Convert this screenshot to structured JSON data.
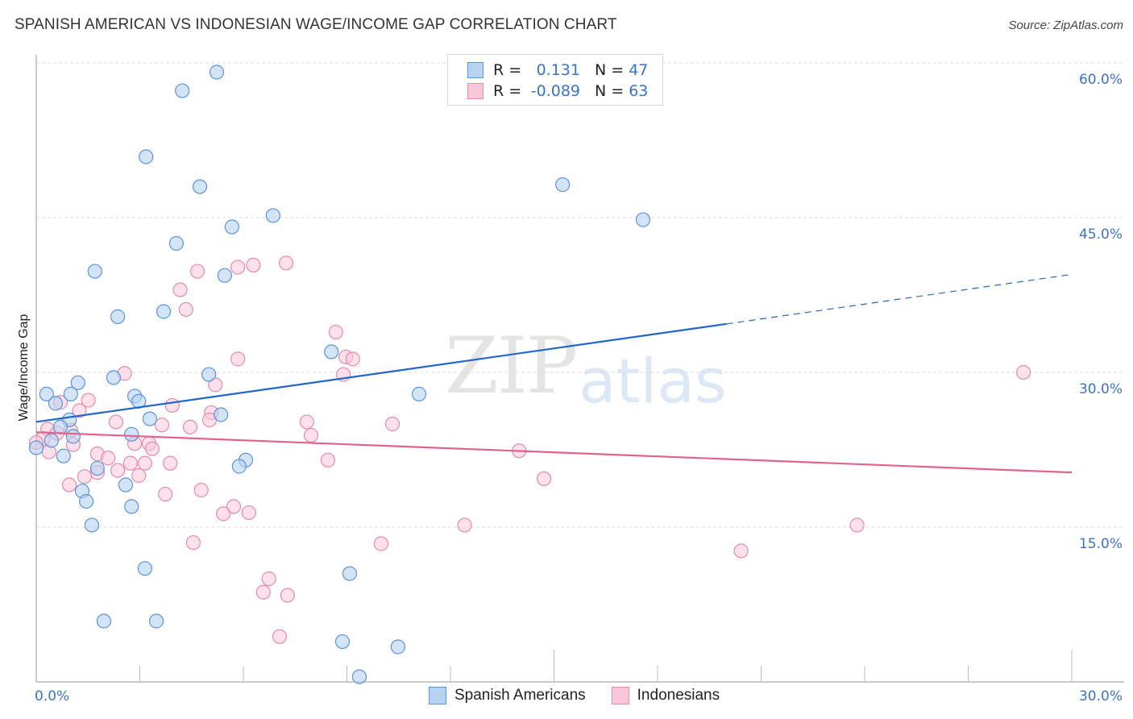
{
  "header": {
    "title": "SPANISH AMERICAN VS INDONESIAN WAGE/INCOME GAP CORRELATION CHART",
    "source": "Source: ZipAtlas.com"
  },
  "watermark": {
    "zip": "ZIP",
    "atlas": "atlas"
  },
  "legend": {
    "rows": [
      {
        "r_label": "R =",
        "r_value": "0.131",
        "n_label": "N =",
        "n_value": "47"
      },
      {
        "r_label": "R =",
        "r_value": "-0.089",
        "n_label": "N =",
        "n_value": "63"
      }
    ]
  },
  "bottom_legend": [
    {
      "label": "Spanish Americans"
    },
    {
      "label": "Indonesians"
    }
  ],
  "colors": {
    "blue_fill": "#b8d2f2",
    "blue_stroke": "#5b93dc",
    "blue_line": "#2266cc",
    "pink_fill": "#f9c8d8",
    "pink_stroke": "#e88aa8",
    "pink_line": "#e0638e",
    "tick_text": "#3a74c9"
  },
  "chart_data": {
    "type": "scatter",
    "title": "SPANISH AMERICAN VS INDONESIAN WAGE/INCOME GAP CORRELATION CHART",
    "xlabel": "",
    "ylabel": "Wage/Income Gap",
    "xlim": [
      0,
      30
    ],
    "ylim": [
      0,
      63
    ],
    "x_tick_labels": [
      "0.0%",
      "30.0%"
    ],
    "y_ticks": [
      15,
      30,
      45,
      60
    ],
    "y_tick_labels": [
      "15.0%",
      "30.0%",
      "45.0%",
      "60.0%"
    ],
    "grid": true,
    "legend_position": "top-center",
    "series": [
      {
        "name": "Spanish Americans",
        "r": 0.131,
        "n": 47,
        "trend": {
          "x0": 0,
          "y0": 25.2,
          "x1": 20,
          "y1": 34.7,
          "dashed_to_x": 30,
          "dashed_to_y": 39.5
        },
        "points": [
          [
            5.23,
            59.1
          ],
          [
            4.23,
            57.3
          ],
          [
            3.18,
            50.9
          ],
          [
            4.74,
            48.0
          ],
          [
            15.25,
            48.2
          ],
          [
            6.86,
            45.2
          ],
          [
            17.58,
            44.8
          ],
          [
            5.67,
            44.1
          ],
          [
            4.06,
            42.5
          ],
          [
            5.46,
            39.4
          ],
          [
            1.7,
            39.8
          ],
          [
            2.36,
            35.4
          ],
          [
            3.69,
            35.9
          ],
          [
            8.55,
            32.0
          ],
          [
            1.21,
            29.0
          ],
          [
            2.24,
            29.5
          ],
          [
            5.0,
            29.8
          ],
          [
            11.09,
            27.9
          ],
          [
            0.3,
            27.9
          ],
          [
            1.0,
            27.9
          ],
          [
            0.56,
            27.0
          ],
          [
            2.85,
            27.7
          ],
          [
            2.97,
            27.2
          ],
          [
            3.29,
            25.5
          ],
          [
            5.35,
            25.9
          ],
          [
            0.96,
            25.4
          ],
          [
            0.7,
            24.7
          ],
          [
            2.76,
            24.0
          ],
          [
            0.44,
            23.4
          ],
          [
            1.07,
            23.8
          ],
          [
            0.0,
            22.7
          ],
          [
            6.07,
            21.5
          ],
          [
            0.79,
            21.9
          ],
          [
            5.88,
            20.9
          ],
          [
            1.77,
            20.7
          ],
          [
            2.59,
            19.1
          ],
          [
            1.33,
            18.5
          ],
          [
            1.45,
            17.5
          ],
          [
            2.76,
            17.0
          ],
          [
            1.61,
            15.2
          ],
          [
            3.15,
            11.0
          ],
          [
            9.08,
            10.5
          ],
          [
            1.96,
            5.9
          ],
          [
            3.48,
            5.9
          ],
          [
            8.87,
            3.9
          ],
          [
            10.48,
            3.4
          ],
          [
            9.36,
            0.5
          ]
        ]
      },
      {
        "name": "Indonesians",
        "r": -0.089,
        "n": 63,
        "trend": {
          "x0": 0,
          "y0": 24.2,
          "x1": 30,
          "y1": 20.3
        },
        "points": [
          [
            6.29,
            40.4
          ],
          [
            7.24,
            40.6
          ],
          [
            4.67,
            39.8
          ],
          [
            5.84,
            40.2
          ],
          [
            4.17,
            38.0
          ],
          [
            4.34,
            36.1
          ],
          [
            8.68,
            33.9
          ],
          [
            5.84,
            31.3
          ],
          [
            8.97,
            31.5
          ],
          [
            9.17,
            31.3
          ],
          [
            2.56,
            29.9
          ],
          [
            8.9,
            29.8
          ],
          [
            28.6,
            30.0
          ],
          [
            5.19,
            28.8
          ],
          [
            1.51,
            27.3
          ],
          [
            0.7,
            27.1
          ],
          [
            3.94,
            26.8
          ],
          [
            1.25,
            26.3
          ],
          [
            5.07,
            26.1
          ],
          [
            2.31,
            25.2
          ],
          [
            5.02,
            25.4
          ],
          [
            7.84,
            25.2
          ],
          [
            10.32,
            25.0
          ],
          [
            3.64,
            24.9
          ],
          [
            4.46,
            24.7
          ],
          [
            0.33,
            24.5
          ],
          [
            1.0,
            24.4
          ],
          [
            0.6,
            24.1
          ],
          [
            7.96,
            23.9
          ],
          [
            0.2,
            23.6
          ],
          [
            2.85,
            23.1
          ],
          [
            3.27,
            23.1
          ],
          [
            1.07,
            23.0
          ],
          [
            3.36,
            22.6
          ],
          [
            13.99,
            22.4
          ],
          [
            0.37,
            22.3
          ],
          [
            1.77,
            22.1
          ],
          [
            2.08,
            21.7
          ],
          [
            8.45,
            21.5
          ],
          [
            2.73,
            21.2
          ],
          [
            3.15,
            21.2
          ],
          [
            3.88,
            21.2
          ],
          [
            2.36,
            20.5
          ],
          [
            1.77,
            20.3
          ],
          [
            2.97,
            20.0
          ],
          [
            1.4,
            19.9
          ],
          [
            14.71,
            19.7
          ],
          [
            0.96,
            19.1
          ],
          [
            4.78,
            18.6
          ],
          [
            3.74,
            18.2
          ],
          [
            5.72,
            17.0
          ],
          [
            5.42,
            16.3
          ],
          [
            6.16,
            16.4
          ],
          [
            12.41,
            15.2
          ],
          [
            23.78,
            15.2
          ],
          [
            4.55,
            13.5
          ],
          [
            9.99,
            13.4
          ],
          [
            20.42,
            12.7
          ],
          [
            6.74,
            10.0
          ],
          [
            6.58,
            8.7
          ],
          [
            7.28,
            8.4
          ],
          [
            7.05,
            4.4
          ],
          [
            0.0,
            23.2
          ]
        ]
      }
    ]
  }
}
